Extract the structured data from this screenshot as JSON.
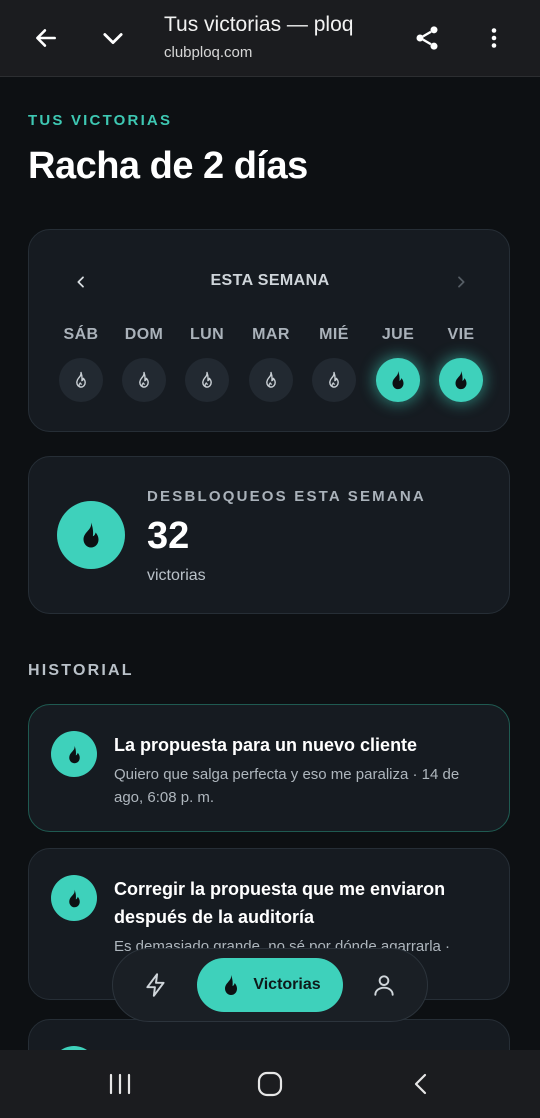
{
  "browser": {
    "title": "Tus victorias — ploq",
    "url": "clubploq.com",
    "icons": [
      "back-arrow-icon",
      "chevron-down-icon",
      "share-icon",
      "more-vert-icon"
    ]
  },
  "page": {
    "eyebrow": "TUS VICTORIAS",
    "title": "Racha de 2 días"
  },
  "week": {
    "label": "ESTA SEMANA",
    "days": [
      {
        "name": "SÁB",
        "active": false
      },
      {
        "name": "DOM",
        "active": false
      },
      {
        "name": "LUN",
        "active": false
      },
      {
        "name": "MAR",
        "active": false
      },
      {
        "name": "MIÉ",
        "active": false
      },
      {
        "name": "JUE",
        "active": true
      },
      {
        "name": "VIE",
        "active": true
      }
    ]
  },
  "unlocks": {
    "label": "DESBLOQUEOS ESTA SEMANA",
    "count": "32",
    "unit": "victorias"
  },
  "history": {
    "title": "HISTORIAL",
    "items": [
      {
        "title": "La propuesta para un nuevo cliente",
        "meta": "Quiero que salga perfecta y eso me paraliza · 14 de ago, 6:08 p. m."
      },
      {
        "title": "Corregir la propuesta que me enviaron después de la auditoría",
        "meta": "Es demasiado grande, no sé por dónde agarrarla ·"
      },
      {
        "title": "",
        "meta": ""
      }
    ]
  },
  "bottom_nav": {
    "active_label": "Victorias",
    "icons": [
      "bolt-icon",
      "flame-icon",
      "user-icon"
    ]
  },
  "colors": {
    "accent": "#3ed1bb",
    "background": "#0d1013",
    "card": "#161b21"
  }
}
